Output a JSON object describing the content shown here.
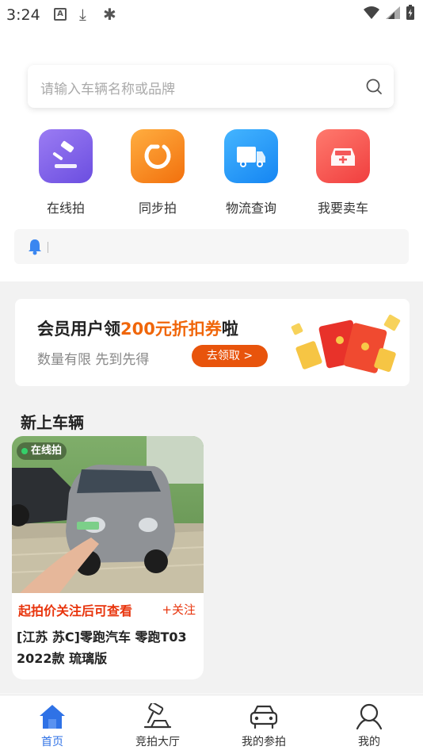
{
  "status_bar": {
    "time": "3:24"
  },
  "search": {
    "placeholder": "请输入车辆名称或品牌"
  },
  "categories": [
    {
      "label": "在线拍",
      "icon": "gavel-icon"
    },
    {
      "label": "同步拍",
      "icon": "sync-icon"
    },
    {
      "label": "物流查询",
      "icon": "truck-icon"
    },
    {
      "label": "我要卖车",
      "icon": "car-icon"
    }
  ],
  "notice": {
    "icon": "bell-icon",
    "text": ""
  },
  "coupon": {
    "title_prefix": "会员用户领",
    "title_highlight": "200元折扣券",
    "title_suffix": "啦",
    "subtitle": "数量有限 先到先得",
    "button": "去领取 >"
  },
  "section": {
    "title": "新上车辆"
  },
  "cars": [
    {
      "badge": "在线拍",
      "price_text": "起拍价关注后可查看",
      "follow": "+关注",
      "name": "[江苏 苏C]零跑汽车 零跑T03 2022款 琉璃版"
    }
  ],
  "tabbar": {
    "items": [
      {
        "label": "首页",
        "icon": "home-icon",
        "active": true
      },
      {
        "label": "竞拍大厅",
        "icon": "auction-hammer-icon",
        "active": false
      },
      {
        "label": "我的参拍",
        "icon": "car-front-icon",
        "active": false
      },
      {
        "label": "我的",
        "icon": "user-icon",
        "active": false
      }
    ]
  },
  "colors": {
    "accent_orange": "#e8540c",
    "price_red": "#e8340c",
    "tab_active_blue": "#2f72e6"
  }
}
